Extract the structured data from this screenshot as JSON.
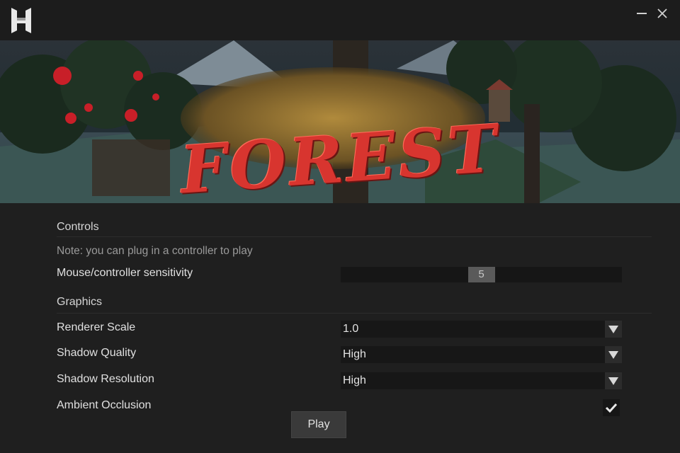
{
  "window": {
    "logo_icon": "h-logo-icon",
    "minimize_icon": "minimize-icon",
    "close_icon": "close-icon"
  },
  "banner": {
    "title": "FOREST",
    "title_color": "#d8352f"
  },
  "controls": {
    "heading": "Controls",
    "note": "Note: you can plug in a controller to play",
    "sensitivity": {
      "label": "Mouse/controller sensitivity",
      "value": "5",
      "level_fraction": 0.5
    }
  },
  "graphics": {
    "heading": "Graphics",
    "renderer_scale": {
      "label": "Renderer Scale",
      "value": "1.0"
    },
    "shadow_quality": {
      "label": "Shadow Quality",
      "value": "High"
    },
    "shadow_resolution": {
      "label": "Shadow Resolution",
      "value": "High"
    },
    "ambient_occlusion": {
      "label": "Ambient Occlusion",
      "checked": true
    }
  },
  "actions": {
    "play_label": "Play"
  }
}
